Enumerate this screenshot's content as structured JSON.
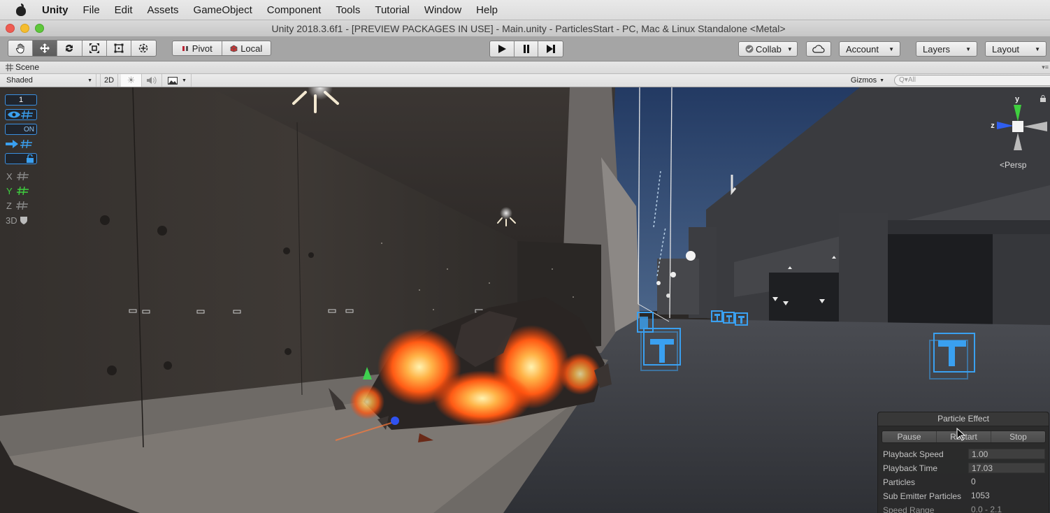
{
  "menubar": {
    "apple_icon": "apple-icon",
    "items": [
      "Unity",
      "File",
      "Edit",
      "Assets",
      "GameObject",
      "Component",
      "Tools",
      "Tutorial",
      "Window",
      "Help"
    ]
  },
  "window": {
    "title": "Unity 2018.3.6f1 - [PREVIEW PACKAGES IN USE] - Main.unity - ParticlesStart - PC, Mac & Linux Standalone <Metal>"
  },
  "toolbar": {
    "tools": [
      {
        "name": "hand-tool",
        "icon": "hand-icon"
      },
      {
        "name": "move-tool",
        "icon": "move-arrows-icon",
        "active": true
      },
      {
        "name": "rotate-tool",
        "icon": "rotate-icon"
      },
      {
        "name": "scale-tool",
        "icon": "scale-icon"
      },
      {
        "name": "rect-tool",
        "icon": "rect-icon"
      },
      {
        "name": "transform-tool",
        "icon": "transform-icon"
      }
    ],
    "pivot_label": "Pivot",
    "local_label": "Local",
    "play_controls": [
      "play",
      "pause",
      "step"
    ],
    "collab_label": "Collab",
    "account_label": "Account",
    "layers_label": "Layers",
    "layout_label": "Layout"
  },
  "scene_tab": {
    "label": "Scene"
  },
  "scene_toolbar": {
    "draw_mode": "Shaded",
    "two_d_label": "2D",
    "gizmos_label": "Gizmos",
    "search_placeholder": "All"
  },
  "overlay": {
    "layer_number": "1",
    "on_label": "ON",
    "axis_x": "X",
    "axis_y": "Y",
    "axis_z": "Z",
    "three_d_label": "3D"
  },
  "orientation_gizmo": {
    "y_label": "y",
    "z_label": "z",
    "projection_label": "Persp",
    "colors": {
      "y": "#3fcf3f",
      "z": "#2f5ef0",
      "x": "#cfcfcf"
    }
  },
  "particle_effect": {
    "title": "Particle Effect",
    "buttons": [
      "Pause",
      "Restart",
      "Stop"
    ],
    "rows": [
      {
        "label": "Playback Speed",
        "value": "1.00",
        "editable": true
      },
      {
        "label": "Playback Time",
        "value": "17.03",
        "editable": true
      },
      {
        "label": "Particles",
        "value": "0",
        "editable": false
      },
      {
        "label": "Sub Emitter Particles",
        "value": "1053",
        "editable": false
      },
      {
        "label": "Speed Range",
        "value": "0.0 - 2.1",
        "editable": false
      }
    ]
  },
  "colors": {
    "accent_blue": "#3a9cf0",
    "fire_orange": "#ff7a1a",
    "sky": "#2f4a78"
  }
}
